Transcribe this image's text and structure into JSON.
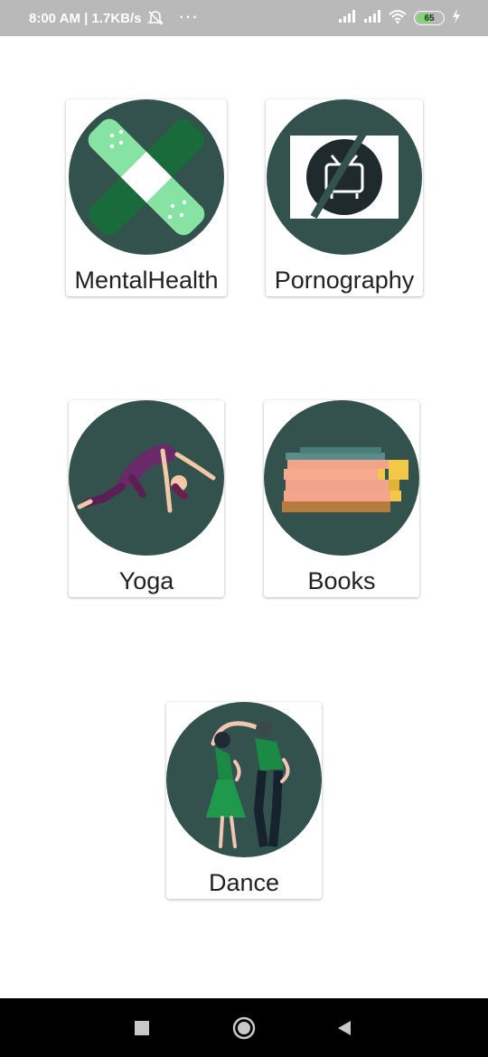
{
  "status_bar": {
    "time_speed": "8:00 AM | 1.7KB/s",
    "overflow_dots": "···",
    "battery_level": "65",
    "icons": [
      "mute-alarm-icon",
      "signal-icon",
      "signal-icon",
      "wifi-icon",
      "battery-icon",
      "charging-icon"
    ]
  },
  "categories": [
    {
      "label": "MentalHealth",
      "icon": "bandage-icon"
    },
    {
      "label": "Pornography",
      "icon": "no-tv-icon"
    },
    {
      "label": "Yoga",
      "icon": "yoga-pose-icon"
    },
    {
      "label": "Books",
      "icon": "book-stack-icon"
    },
    {
      "label": "Dance",
      "icon": "dancing-couple-icon"
    }
  ],
  "colors": {
    "circle_bg": "#33514d",
    "status_bar_bg": "#b9b9b9",
    "nav_bar_bg": "#000000",
    "battery_fill": "#7dd66f",
    "card_text": "#222222"
  },
  "nav_bar": {
    "buttons": [
      "recents-square-icon",
      "home-circle-icon",
      "back-triangle-icon"
    ]
  }
}
